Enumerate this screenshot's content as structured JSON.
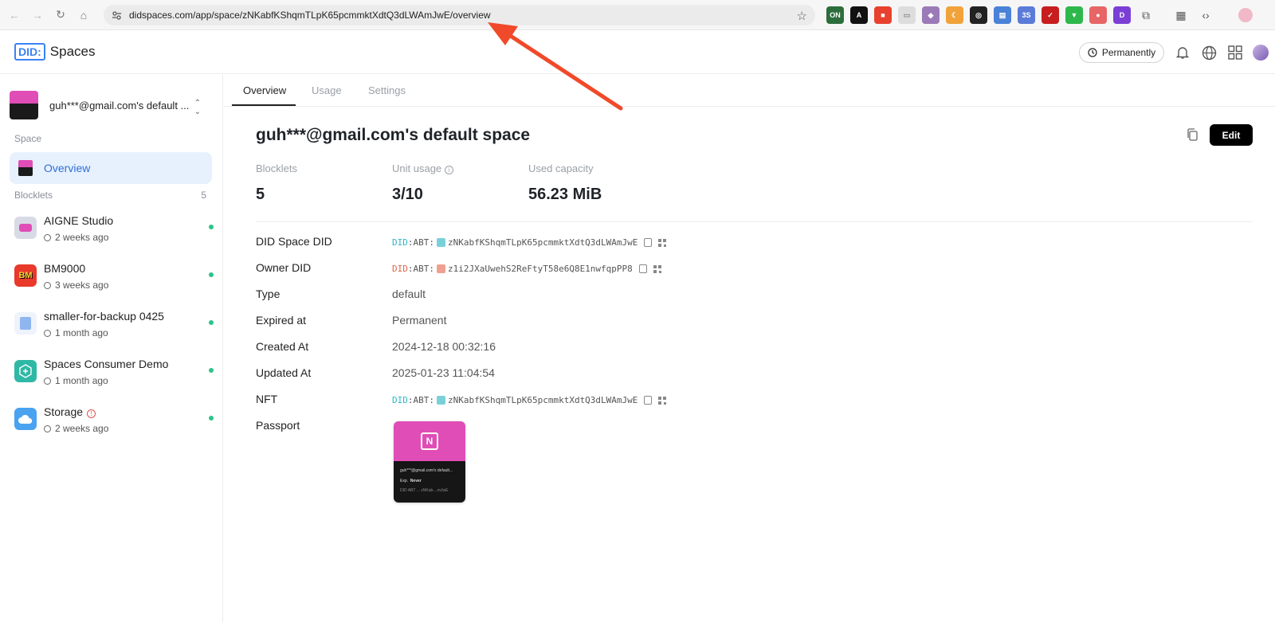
{
  "browser": {
    "url": "didspaces.com/app/space/zNKabfKShqmTLpK65pcmmktXdtQ3dLWAmJwE/overview"
  },
  "header": {
    "logo_mark": "DID:",
    "logo_text": "Spaces",
    "permanence_label": "Permanently"
  },
  "sidebar": {
    "space_name": "guh***@gmail.com's default ...",
    "space_section": "Space",
    "overview_label": "Overview",
    "blocklets_section": "Blocklets",
    "blocklets_count": "5",
    "blocklets": [
      {
        "name": "AIGNE Studio",
        "time": "2 weeks ago",
        "icon": "aigne-icon",
        "color": "#d8dbe6"
      },
      {
        "name": "BM9000",
        "time": "3 weeks ago",
        "icon": "bm9000-icon",
        "color": "#e8392b"
      },
      {
        "name": "smaller-for-backup 0425",
        "time": "1 month ago",
        "icon": "backup-doc-icon",
        "color": "#dfe9fb"
      },
      {
        "name": "Spaces Consumer Demo",
        "time": "1 month ago",
        "icon": "hexagon-plus-icon",
        "color": "#2fb8a6"
      },
      {
        "name": "Storage",
        "time": "2 weeks ago",
        "icon": "cloud-icon",
        "color": "#4aa3f0"
      }
    ]
  },
  "tabs": [
    "Overview",
    "Usage",
    "Settings"
  ],
  "main": {
    "title": "guh***@gmail.com's default space",
    "edit_label": "Edit",
    "stats": [
      {
        "label": "Blocklets",
        "value": "5"
      },
      {
        "label": "Unit usage",
        "value": "3/10"
      },
      {
        "label": "Used capacity",
        "value": "56.23 MiB"
      }
    ],
    "details": {
      "space_did_label": "DID Space DID",
      "space_did_prefix": "DID",
      "space_did_type": ":ABT:",
      "space_did_value": "zNKabfKShqmTLpK65pcmmktXdtQ3dLWAmJwE",
      "owner_did_label": "Owner DID",
      "owner_did_prefix": "DID",
      "owner_did_type": ":ABT:",
      "owner_did_value": "z1i2JXaUwehS2ReFtyT58e6Q8E1nwfqpPP8",
      "type_label": "Type",
      "type_value": "default",
      "expired_label": "Expired at",
      "expired_value": "Permanent",
      "created_label": "Created At",
      "created_value": "2024-12-18 00:32:16",
      "updated_label": "Updated At",
      "updated_value": "2025-01-23 11:04:54",
      "nft_label": "NFT",
      "nft_prefix": "DID",
      "nft_type": ":ABT:",
      "nft_value": "zNKabfKShqmTLpK65pcmmktXdtQ3dLWAmJwE",
      "passport_label": "Passport"
    },
    "passport_card": {
      "line1": "guh***@gmail.com's default...",
      "exp_label": "Exp.",
      "exp_value": "Never",
      "did_line": "DID ABT ... zNKab....mJwE"
    }
  },
  "colors": {
    "accent": "#2f6fd6",
    "annotation_arrow": "#f04a2a",
    "status_dot": "#2bc48a",
    "passport_pink": "#e04db6"
  }
}
